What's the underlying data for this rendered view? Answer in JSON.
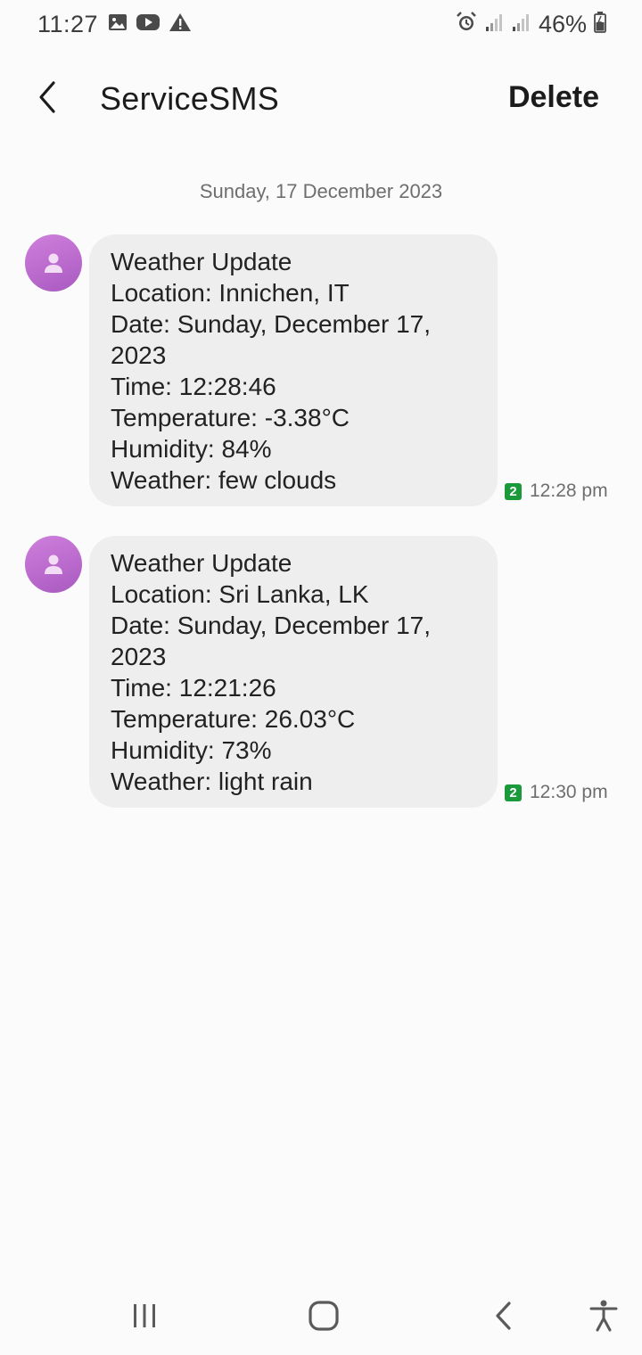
{
  "status_bar": {
    "time": "11:27",
    "battery_percent": "46%",
    "icons": [
      "gallery-icon",
      "youtube-icon",
      "warning-icon",
      "alarm-icon",
      "signal-icon",
      "signal-icon",
      "battery-icon"
    ]
  },
  "header": {
    "title": "ServiceSMS",
    "delete_label": "Delete"
  },
  "conversation": {
    "date_separator": "Sunday, 17 December 2023",
    "messages": [
      {
        "lines": [
          "Weather Update",
          "Location: Innichen, IT",
          "Date: Sunday, December 17,",
          "2023",
          "Time: 12:28:46",
          "Temperature: -3.38°C",
          "Humidity: 84%",
          "Weather: few clouds"
        ],
        "sim": "2",
        "time": "12:28 pm"
      },
      {
        "lines": [
          "Weather Update",
          "Location: Sri Lanka, LK",
          "Date: Sunday, December 17,",
          "2023",
          "Time: 12:21:26",
          "Temperature: 26.03°C",
          "Humidity: 73%",
          "Weather: light rain"
        ],
        "sim": "2",
        "time": "12:30 pm"
      }
    ]
  },
  "colors": {
    "background": "#fbfbfb",
    "bubble": "#eeeeee",
    "avatar": "#b968cc",
    "sim_badge": "#1a9a3a"
  },
  "nav_bar": {
    "icons": [
      "recents-icon",
      "home-icon",
      "back-icon",
      "accessibility-icon"
    ]
  }
}
